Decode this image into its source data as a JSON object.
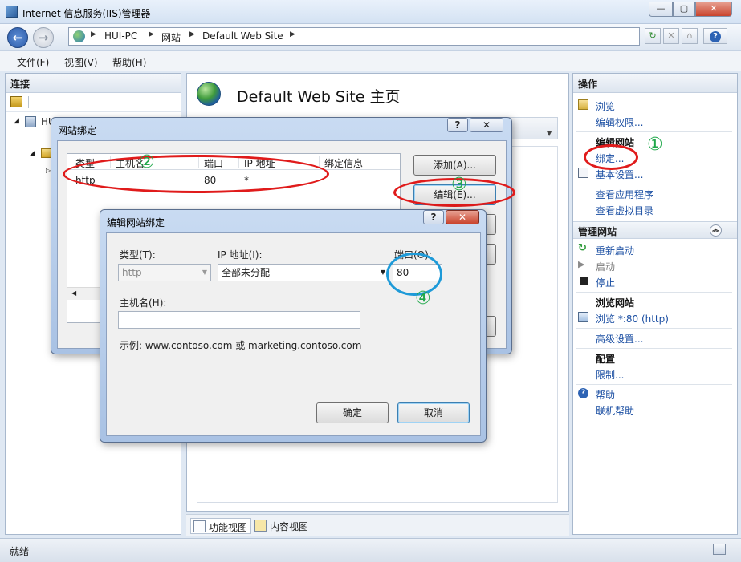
{
  "window": {
    "title": "Internet 信息服务(IIS)管理器",
    "min_glyph": "—",
    "max_glyph": "▢",
    "close_glyph": "✕"
  },
  "address": {
    "crumbs": [
      "HUI-PC",
      "网站",
      "Default Web Site"
    ],
    "sep": "▶"
  },
  "toolbar": {
    "help_glyph": "?"
  },
  "menu": [
    "文件(F)",
    "视图(V)",
    "帮助(H)"
  ],
  "connections": {
    "title": "连接",
    "tree_root": "HU"
  },
  "center": {
    "title": "Default Web Site 主页",
    "tabs": [
      "功能视图",
      "内容视图"
    ]
  },
  "actions": {
    "title": "操作",
    "browse": "浏览",
    "edit_perms": "编辑权限...",
    "edit_site_head": "编辑网站",
    "bindings": "绑定...",
    "basic_settings": "基本设置...",
    "view_apps": "查看应用程序",
    "view_vdirs": "查看虚拟目录",
    "manage_site_head": "管理网站",
    "restart": "重新启动",
    "start": "启动",
    "stop": "停止",
    "browse_site_head": "浏览网站",
    "browse_port": "浏览 *:80 (http)",
    "advanced": "高级设置...",
    "config_head": "配置",
    "limits": "限制...",
    "help_head": "帮助",
    "online_help": "联机帮助",
    "collapse_glyph": "︽"
  },
  "status": {
    "text": "就绪"
  },
  "bindings_dialog": {
    "title": "网站绑定",
    "help_glyph": "?",
    "close_glyph": "✕",
    "columns": [
      "类型",
      "主机名",
      "端口",
      "IP 地址",
      "绑定信息"
    ],
    "rows": [
      {
        "type": "http",
        "host": "",
        "port": "80",
        "ip": "*",
        "info": ""
      }
    ],
    "add_button": "添加(A)...",
    "edit_button": "编辑(E)..."
  },
  "edit_dialog": {
    "title": "编辑网站绑定",
    "help_glyph": "?",
    "close_glyph": "✕",
    "type_label": "类型(T):",
    "type_value": "http",
    "ip_label": "IP 地址(I):",
    "ip_value": "全部未分配",
    "port_label": "端口(O):",
    "port_value": "80",
    "host_label": "主机名(H):",
    "host_value": "",
    "example": "示例: www.contoso.com 或 marketing.contoso.com",
    "ok_button": "确定",
    "cancel_button": "取消"
  },
  "annotations": {
    "step1": "①",
    "step2": "②",
    "step3": "③",
    "step4": "④",
    "red": "#e01b1b",
    "green": "#1fa84a",
    "blue": "#1e9ad8"
  }
}
